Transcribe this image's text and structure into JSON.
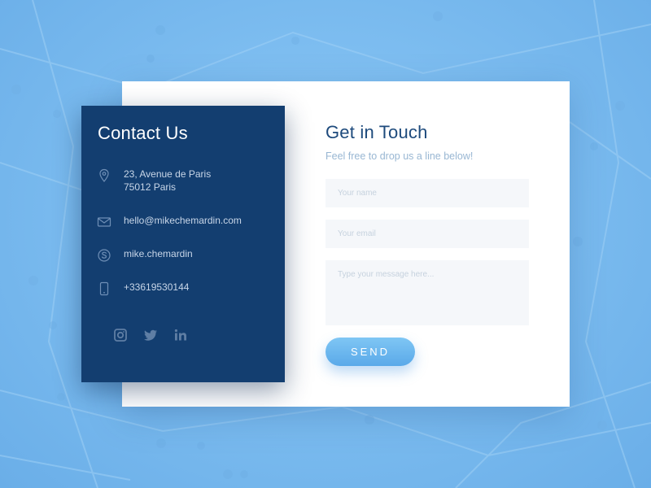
{
  "colors": {
    "background": "#7dbdf0",
    "panel": "#133e70",
    "card": "#ffffff",
    "heading": "#1d4a7c",
    "subtle_text": "#99b7d3",
    "field_bg": "#f5f7fa",
    "button": "#6ab5ef"
  },
  "contact": {
    "title": "Contact Us",
    "address_line1": "23, Avenue de Paris",
    "address_line2": "75012 Paris",
    "email": "hello@mikechemardin.com",
    "skype": "mike.chemardin",
    "phone": "+33619530144",
    "icons": [
      "map-pin-icon",
      "mail-icon",
      "skype-icon",
      "phone-icon"
    ],
    "social": [
      "instagram-icon",
      "twitter-icon",
      "linkedin-icon"
    ]
  },
  "form": {
    "title": "Get in Touch",
    "subtitle": "Feel free to drop us a line below!",
    "name_placeholder": "Your name",
    "email_placeholder": "Your email",
    "message_placeholder": "Type your message here...",
    "send_label": "SEND"
  }
}
